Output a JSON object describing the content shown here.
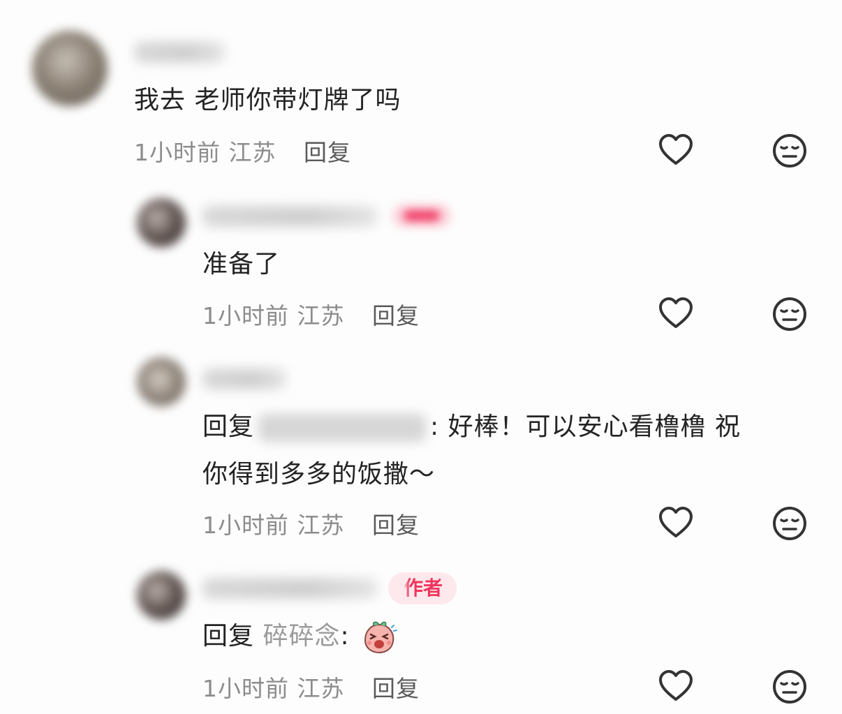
{
  "comments": [
    {
      "text": "我去 老师你带灯牌了吗",
      "time": "1小时前",
      "location": "江苏",
      "reply_label": "回复"
    },
    {
      "text": "准备了",
      "time": "1小时前",
      "location": "江苏",
      "reply_label": "回复"
    },
    {
      "reply_prefix": "回复",
      "text_line1": ": 好棒！可以安心看橹橹 祝",
      "text_line2": "你得到多多的饭撒～",
      "time": "1小时前",
      "location": "江苏",
      "reply_label": "回复"
    },
    {
      "author_badge": "作者",
      "reply_prefix": "回复",
      "reply_target": "碎碎念",
      "reply_colon": ":",
      "time": "1小时前",
      "location": "江苏",
      "reply_label": "回复"
    }
  ],
  "icons": {
    "like": "heart-outline-icon",
    "dislike": "neutral-face-icon",
    "sticker": "laughing-peach-sticker"
  },
  "colors": {
    "author_badge_text": "#f0355e",
    "author_badge_bg": "#fde8ec",
    "meta_text": "#8c8c8c",
    "body_text": "#232323"
  }
}
